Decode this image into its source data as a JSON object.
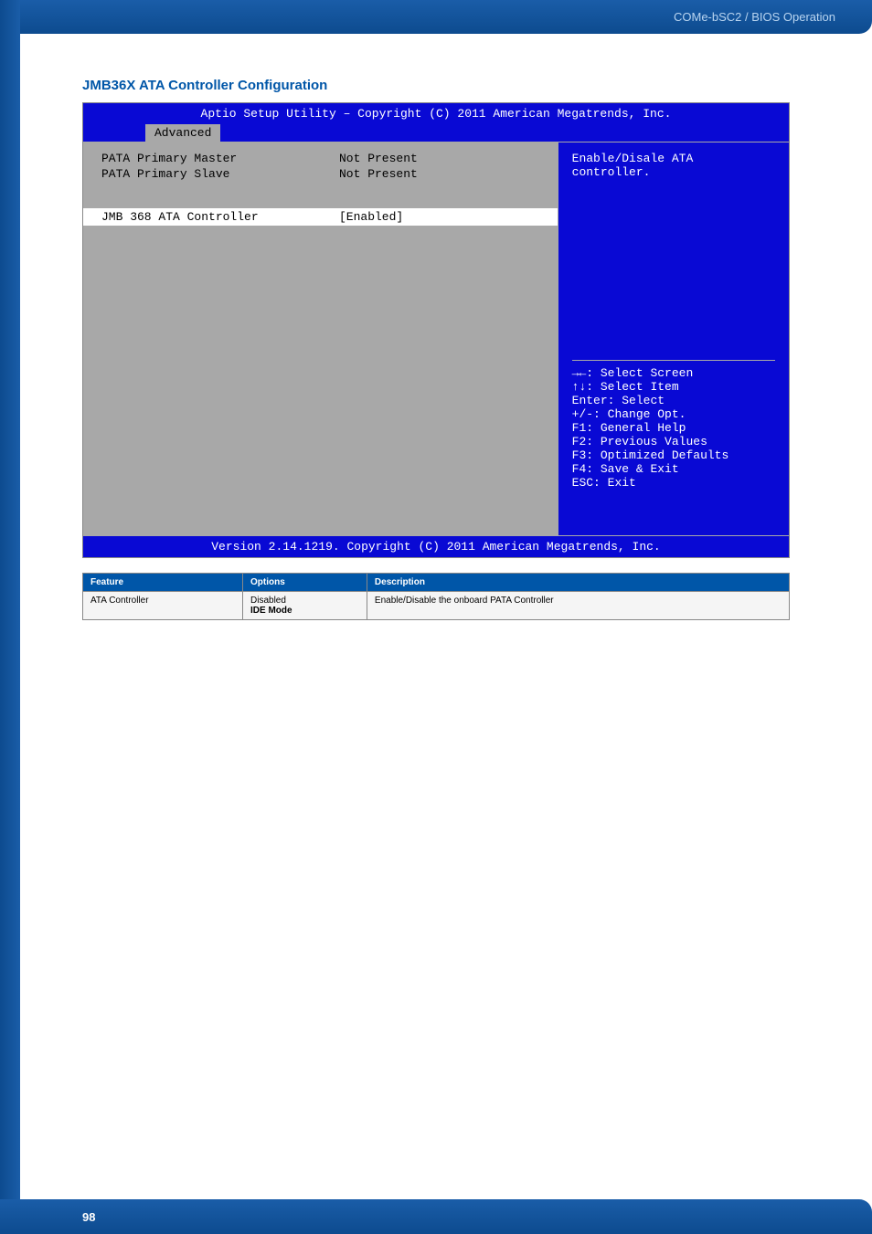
{
  "header": {
    "breadcrumb": "COMe-bSC2 / BIOS Operation"
  },
  "section": {
    "title": "JMB36X ATA Controller Configuration"
  },
  "bios": {
    "title": "Aptio Setup Utility – Copyright (C) 2011 American Megatrends, Inc.",
    "tab": "Advanced",
    "rows": {
      "master_label": "PATA Primary Master",
      "master_value": "Not Present",
      "slave_label": "PATA Primary Slave",
      "slave_value": "Not Present",
      "controller_label": "JMB 368 ATA Controller",
      "controller_value": "[Enabled]"
    },
    "help": "Enable/Disale ATA controller.",
    "hints": {
      "l1": "→←: Select Screen",
      "l2": "↑↓: Select Item",
      "l3": "Enter: Select",
      "l4": "+/-: Change Opt.",
      "l5": "F1: General Help",
      "l6": "F2: Previous Values",
      "l7": "F3: Optimized Defaults",
      "l8": "F4: Save & Exit",
      "l9": "ESC: Exit"
    },
    "footer": "Version 2.14.1219. Copyright (C) 2011 American Megatrends, Inc."
  },
  "table": {
    "headers": {
      "feature": "Feature",
      "options": "Options",
      "description": "Description"
    },
    "row": {
      "feature": "ATA Controller",
      "option1": "Disabled",
      "option2": "IDE Mode",
      "description": "Enable/Disable the onboard PATA Controller"
    }
  },
  "footer": {
    "page": "98"
  }
}
